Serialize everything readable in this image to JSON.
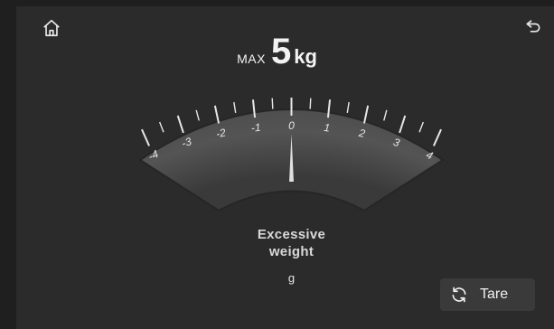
{
  "header": {
    "home_icon": "home-icon",
    "back_icon": "back-arrow-icon"
  },
  "capacity": {
    "max_label": "MAX",
    "max_value": "5",
    "unit": "kg"
  },
  "gauge": {
    "min": -5,
    "max": 5,
    "needle_value": 0,
    "tick_labels": [
      "-4",
      "-3",
      "-2",
      "-1",
      "0",
      "1",
      "2",
      "3",
      "4"
    ]
  },
  "status": {
    "line1": "Excessive",
    "line2": "weight"
  },
  "reading": {
    "unit": "g"
  },
  "tare": {
    "icon": "refresh-icon",
    "label": "Tare"
  },
  "colors": {
    "background": "#2b2b2b",
    "dial": "#555555",
    "needle": "#e0e0e0",
    "text": "#f2f2f2"
  }
}
